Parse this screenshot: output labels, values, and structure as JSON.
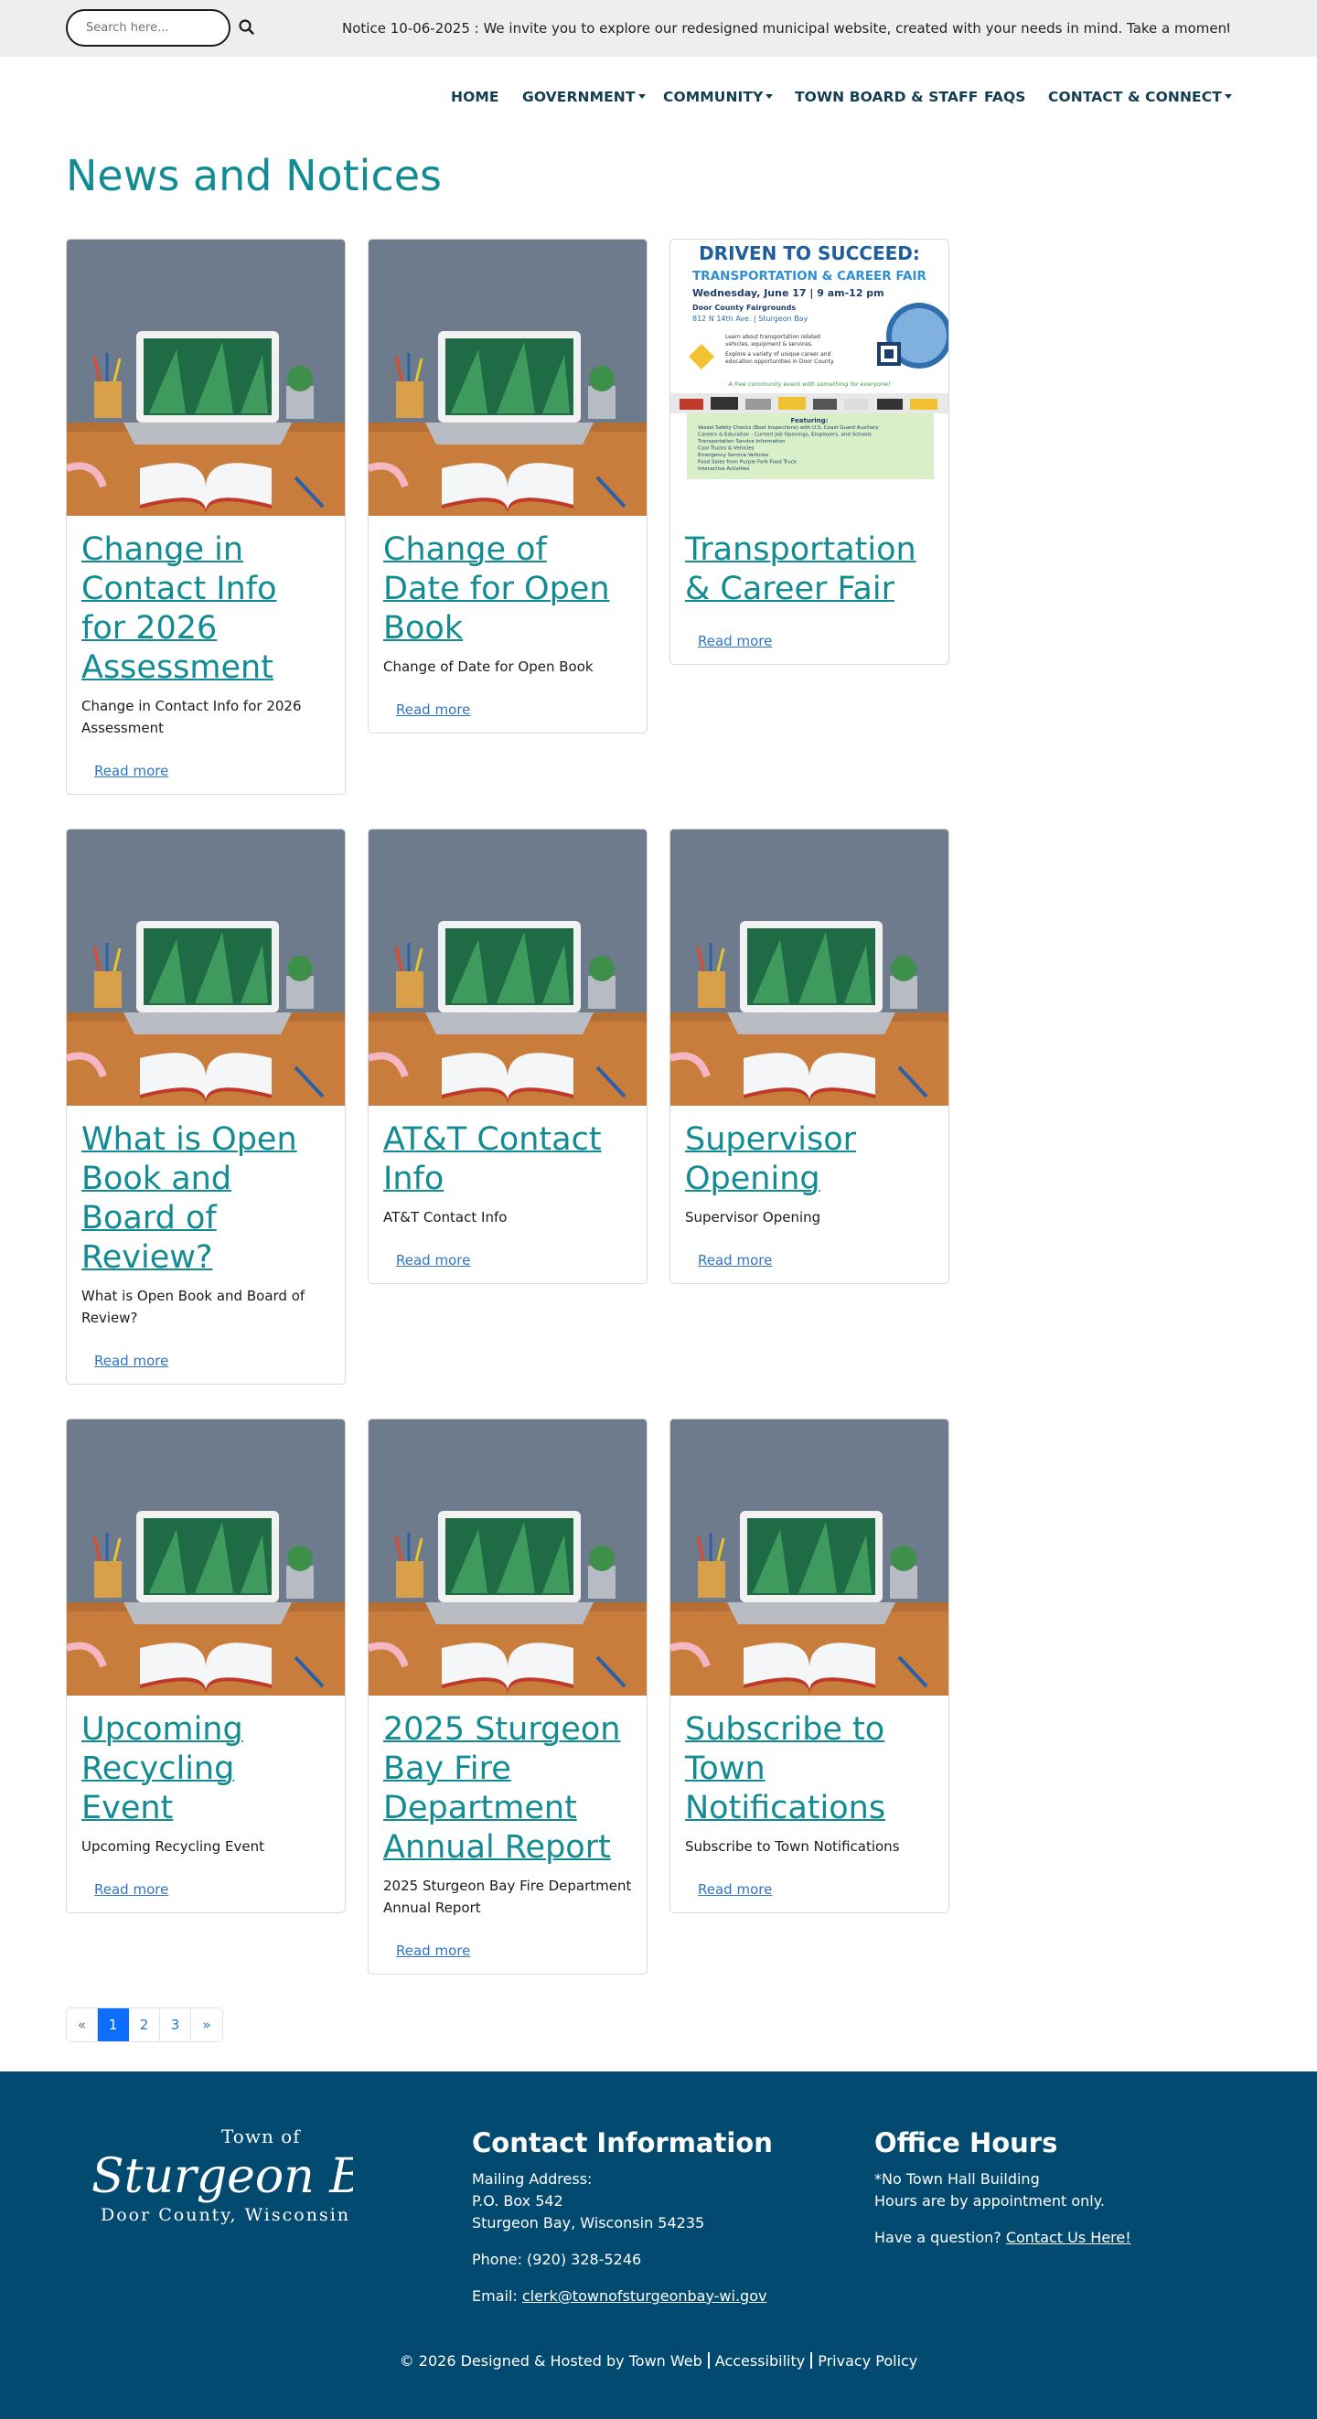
{
  "topbar": {
    "search_placeholder": "Search here...",
    "notice": "Notice 10-06-2025 : We invite you to explore our redesigned municipal website, created with your needs in mind. Take a moment"
  },
  "nav": {
    "items": [
      "HOME",
      "GOVERNMENT",
      "COMMUNITY",
      "TOWN BOARD & STAFF",
      "FAQS",
      "CONTACT & CONNECT"
    ]
  },
  "page": {
    "title": "News and Notices"
  },
  "cards": [
    {
      "title": "Change in Contact Info for 2026 Assessment",
      "desc": "Change in Contact Info for 2026 Assessment",
      "link": "Read more",
      "image": "desk-laptop"
    },
    {
      "title": "Change of Date for Open Book",
      "desc": "Change of Date for Open Book",
      "link": "Read more",
      "image": "desk-laptop"
    },
    {
      "title": "Transportation & Career Fair",
      "desc": "",
      "link": "Read more",
      "image": "flyer"
    },
    {
      "title": "What is Open Book and Board of Review?",
      "desc": "What is Open Book and Board of Review?",
      "link": "Read more",
      "image": "desk-laptop"
    },
    {
      "title": "AT&T Contact Info",
      "desc": "AT&T Contact Info",
      "link": "Read more",
      "image": "desk-laptop"
    },
    {
      "title": "Supervisor Opening",
      "desc": "Supervisor Opening",
      "link": "Read more",
      "image": "desk-laptop"
    },
    {
      "title": "Upcoming Recycling Event",
      "desc": "Upcoming Recycling Event",
      "link": "Read more",
      "image": "desk-laptop"
    },
    {
      "title": "2025 Sturgeon Bay Fire Department Annual Report",
      "desc": "2025 Sturgeon Bay Fire Department Annual Report",
      "link": "Read more",
      "image": "desk-laptop"
    },
    {
      "title": "Subscribe to Town Notifications",
      "desc": "Subscribe to Town Notifications",
      "link": "Read more",
      "image": "desk-laptop"
    }
  ],
  "flyer": {
    "heading1": "DRIVEN TO SUCCEED:",
    "heading2": "TRANSPORTATION & CAREER FAIR",
    "date": "Wednesday, June 17 | 9 am-12 pm",
    "venue": "Door County Fairgrounds",
    "address": "812 N 14th Ave. | Sturgeon Bay",
    "blurb1": "Learn about transportation related",
    "blurb2": "vehicles, equipment & services.",
    "blurb3": "Explore a variety of unique career and",
    "blurb4": "education opportunities in Door County.",
    "tagline": "A free community event with something for everyone!",
    "featuring": "Featuring:",
    "features": [
      "Vessel Safety Checks (Boat Inspections) with U.S. Coast Guard Auxiliary",
      "Careers & Education - Current Job Openings, Employers, and Schools",
      "Transportation Service Information",
      "Cool Trucks & Vehicles",
      "Emergency Service Vehicles",
      "Food Sales from Purple Fork Food Truck",
      "Interactive Activities"
    ]
  },
  "pagination": {
    "prev": "«",
    "pages": [
      "1",
      "2",
      "3"
    ],
    "next": "»",
    "active": "1"
  },
  "footer": {
    "logo": {
      "line1": "Town of",
      "line2": "Sturgeon Bay",
      "line3": "Door County, Wisconsin"
    },
    "contact": {
      "title": "Contact Information",
      "mailing_label": "Mailing Address:",
      "po": "P.O. Box 542",
      "city": "Sturgeon Bay, Wisconsin 54235",
      "phone": "Phone: (920) 328-5246",
      "email_label": "Email: ",
      "email": "clerk@townofsturgeonbay-wi.gov"
    },
    "hours": {
      "title": "Office Hours",
      "line1": "*No Town Hall Building",
      "line2": "Hours are by appointment only.",
      "question": "Have a question? ",
      "contact_link": "Contact Us Here!"
    },
    "bottom": {
      "copy": "© 2026 Designed & Hosted by ",
      "townweb": "Town Web",
      "accessibility": "Accessibility",
      "privacy": "Privacy Policy"
    }
  }
}
